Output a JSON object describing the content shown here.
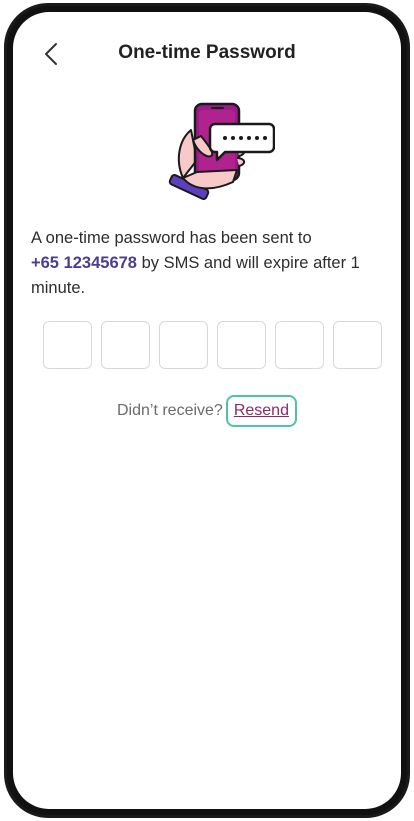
{
  "header": {
    "title": "One-time Password",
    "back_icon": "chevron-left-icon"
  },
  "illustration": {
    "icon": "phone-sms-icon",
    "colors": {
      "phone": "#9c1a8a",
      "hand": "#f7c9c9",
      "cuff": "#5b3fbf"
    }
  },
  "message": {
    "before": "A one-time password has been sent to",
    "phone": "+65 12345678",
    "after": " by SMS and will expire after 1 minute."
  },
  "otp": {
    "digits": [
      "",
      "",
      "",
      "",
      "",
      ""
    ]
  },
  "resend": {
    "prompt": "Didn’t receive?",
    "label": "Resend"
  },
  "colors": {
    "accent": "#4a3f8f",
    "resend_text": "#8b2a6b",
    "focus_ring": "#4fc2a8"
  }
}
